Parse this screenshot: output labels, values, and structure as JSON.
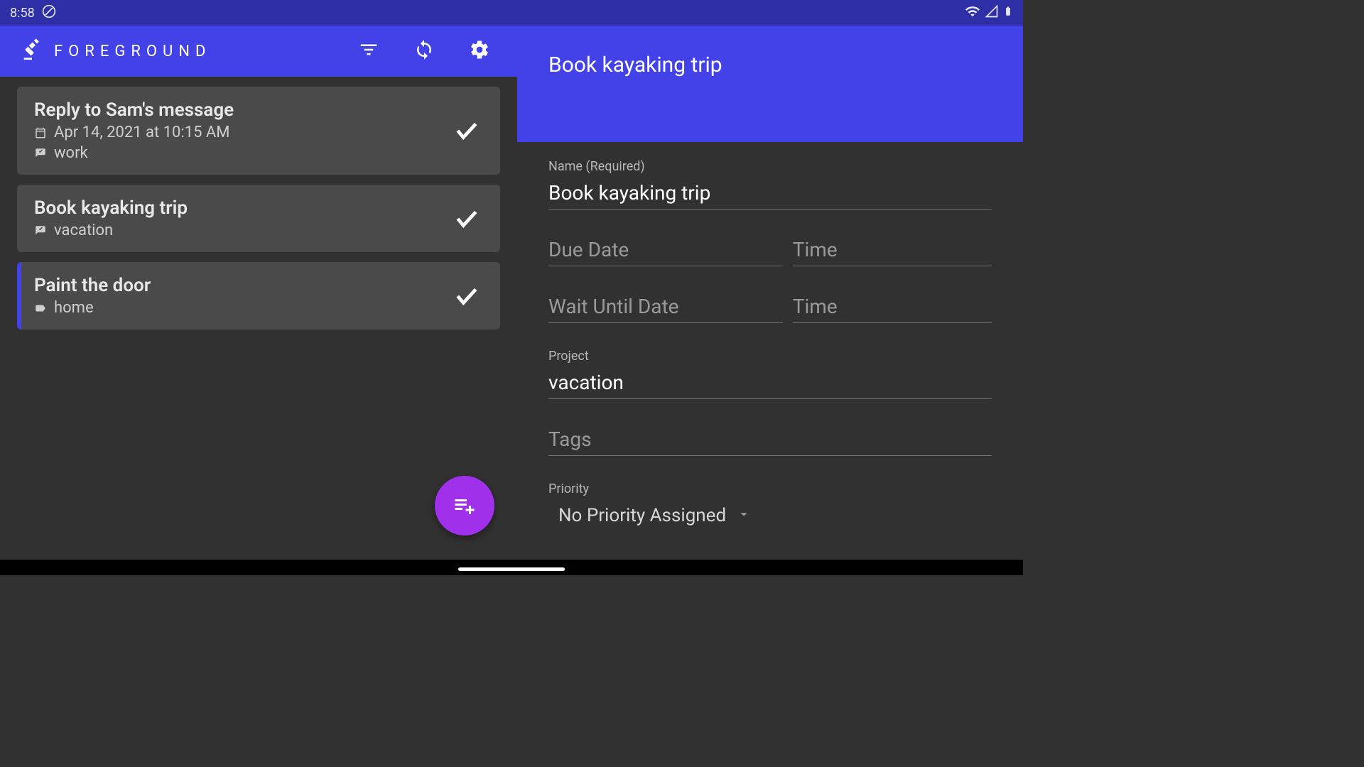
{
  "status_bar": {
    "time": "8:58",
    "icons": [
      "no-disturb-icon",
      "wifi-icon",
      "signal-icon",
      "battery-icon"
    ]
  },
  "app": {
    "brand": "FOREGROUND",
    "actions": [
      "filter-icon",
      "sync-icon",
      "settings-icon"
    ]
  },
  "tasks": [
    {
      "title": "Reply to Sam's message",
      "date": "Apr 14, 2021 at 10:15 AM",
      "tag": "work",
      "has_date": true,
      "tag_icon": "project-icon",
      "selected": false
    },
    {
      "title": "Book kayaking trip",
      "date": "",
      "tag": "vacation",
      "has_date": false,
      "tag_icon": "project-icon",
      "selected": false
    },
    {
      "title": "Paint the door",
      "date": "",
      "tag": "home",
      "has_date": false,
      "tag_icon": "label-icon",
      "selected": true
    }
  ],
  "fab": {
    "icon": "playlist-add-icon"
  },
  "detail": {
    "header_title": "Book kayaking trip",
    "name": {
      "label": "Name (Required)",
      "value": "Book kayaking trip"
    },
    "due_date": {
      "placeholder": "Due Date",
      "value": ""
    },
    "due_time": {
      "placeholder": "Time",
      "value": ""
    },
    "wait_date": {
      "placeholder": "Wait Until Date",
      "value": ""
    },
    "wait_time": {
      "placeholder": "Time",
      "value": ""
    },
    "project": {
      "label": "Project",
      "value": "vacation"
    },
    "tags": {
      "placeholder": "Tags",
      "value": ""
    },
    "priority": {
      "label": "Priority",
      "value": "No Priority Assigned"
    }
  }
}
